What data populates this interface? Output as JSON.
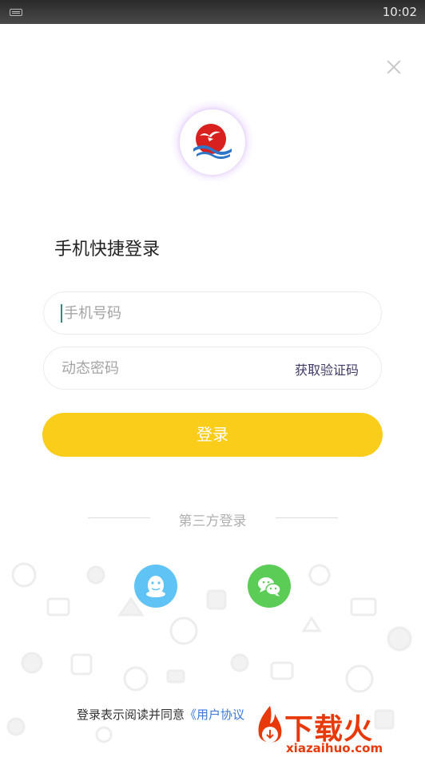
{
  "status_bar": {
    "time": "10:02"
  },
  "title": "手机快捷登录",
  "phone_input": {
    "placeholder": "手机号码",
    "value": ""
  },
  "code_input": {
    "placeholder": "动态密码",
    "value": ""
  },
  "get_code_label": "获取验证码",
  "login_label": "登录",
  "third_party_label": "第三方登录",
  "social": [
    {
      "name": "QQ",
      "icon": "qq-icon",
      "color": "#5fc3f5"
    },
    {
      "name": "WeChat",
      "icon": "wechat-icon",
      "color": "#5bcc55"
    }
  ],
  "agreement": {
    "prefix": "登录表示阅读并同意",
    "link": "《用户协议"
  },
  "watermark": {
    "brand": "下载火",
    "url": "xiazaihuo.com"
  },
  "colors": {
    "primary_button": "#f9cd1a",
    "link": "#3c78d8",
    "watermark": "#e8390a",
    "logo_red": "#d8201e",
    "logo_blue": "#2f76c9"
  }
}
